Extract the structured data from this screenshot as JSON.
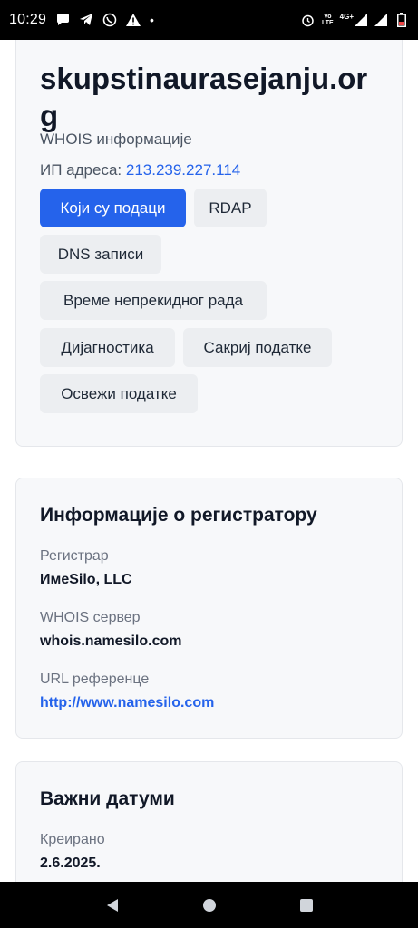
{
  "status_bar": {
    "time": "10:29",
    "dot": "•",
    "net_label_top": "Vo",
    "net_label_bottom": "LTE",
    "net_gen": "4G+"
  },
  "domain": {
    "name": "skupstinaurasejanju.org",
    "subtitle": "WHOIS информације",
    "ip_label": "ИП адреса:",
    "ip_value": "213.239.227.114"
  },
  "buttons": {
    "data": "Који су подаци",
    "rdap": "RDAP",
    "dns": "DNS записи",
    "uptime": "Време непрекидног рада",
    "diagnostics": "Дијагностика",
    "hide": "Сакриј податке",
    "refresh": "Освежи податке"
  },
  "registrar_section": {
    "title": "Информације о регистратору",
    "registrar_label": "Регистрар",
    "registrar_value": "ИмеSilo, LLC",
    "whois_label": "WHOIS сервер",
    "whois_value": "whois.namesilo.com",
    "url_label": "URL референце",
    "url_value": "http://www.namesilo.com"
  },
  "dates_section": {
    "title": "Важни датуми",
    "created_label": "Креирано",
    "created_value": "2.6.2025."
  },
  "colors": {
    "primary": "#2563eb",
    "card_bg": "#f7f8fa",
    "secondary_btn": "#eceef1"
  }
}
